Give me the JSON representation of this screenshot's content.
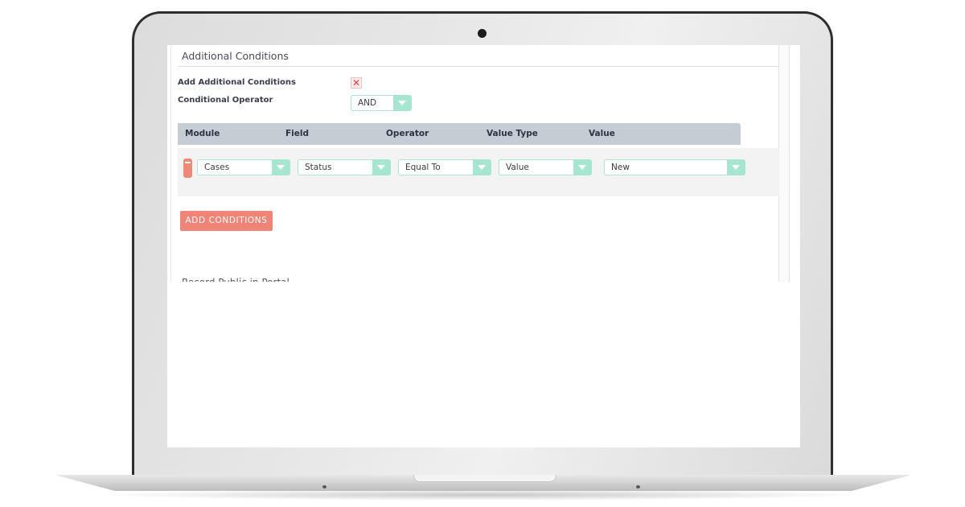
{
  "section": {
    "title": "Additional Conditions",
    "add_conditions_label": "Add Additional Conditions",
    "add_conditions_checked": true,
    "checkbox_glyph": "✕",
    "operator_label": "Conditional Operator",
    "operator_value": "AND"
  },
  "table": {
    "headers": [
      "Module",
      "Field",
      "Operator",
      "Value Type",
      "Value"
    ],
    "rows": [
      {
        "module": "Cases",
        "field": "Status",
        "operator": "Equal To",
        "value_type": "Value",
        "value": "New"
      }
    ]
  },
  "buttons": {
    "add_conditions": "ADD CONDITIONS",
    "remove_row_icon": "minus-icon"
  },
  "next_section_title_partial": "Record Public in Portal",
  "colors": {
    "accent_teal": "#a6e6d0",
    "danger_salmon": "#f08476",
    "header_gray": "#c5ccd4"
  }
}
